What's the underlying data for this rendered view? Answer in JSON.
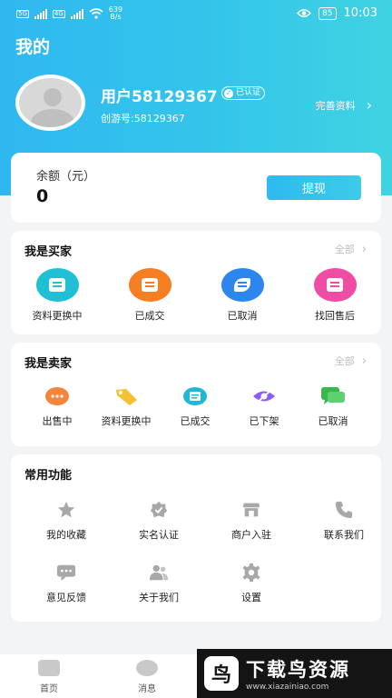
{
  "status_bar": {
    "time": "10:03",
    "battery": "85",
    "net_speed": "639",
    "net_unit": "B/s",
    "sim_tag": "5G",
    "sim_tag2": "4G"
  },
  "header": {
    "title": "我的"
  },
  "profile": {
    "username": "用户58129367",
    "verified_badge": "已认证",
    "chuangyou_id": "创游号:58129367",
    "complete_profile": "完善资料"
  },
  "balance": {
    "label": "余额（元）",
    "value": "0",
    "withdraw_button": "提现"
  },
  "buyer": {
    "title": "我是买家",
    "all": "全部",
    "items": [
      {
        "label": "资料更换中",
        "icon": "document-icon",
        "color": "#1fc0d4"
      },
      {
        "label": "已成交",
        "icon": "bag-icon",
        "color": "#f57f22"
      },
      {
        "label": "已取消",
        "icon": "leaf-icon",
        "color": "#2d86ee"
      },
      {
        "label": "找回售后",
        "icon": "list-icon",
        "color": "#ee4da3"
      }
    ]
  },
  "seller": {
    "title": "我是卖家",
    "all": "全部",
    "items": [
      {
        "label": "出售中",
        "icon": "dots-icon",
        "color": "#f5853a"
      },
      {
        "label": "资料更换中",
        "icon": "tag-icon",
        "color": "#f5c032"
      },
      {
        "label": "已成交",
        "icon": "receipt-icon",
        "color": "#1fb6d8"
      },
      {
        "label": "已下架",
        "icon": "hidden-eye-icon",
        "color": "#8a5ef0"
      },
      {
        "label": "已取消",
        "icon": "chat-icon",
        "color": "#37b84a"
      }
    ]
  },
  "common": {
    "title": "常用功能",
    "items": [
      {
        "label": "我的收藏",
        "icon": "star-icon"
      },
      {
        "label": "实名认证",
        "icon": "verified-shield-icon"
      },
      {
        "label": "商户入驻",
        "icon": "store-icon"
      },
      {
        "label": "联系我们",
        "icon": "phone-icon"
      },
      {
        "label": "意见反馈",
        "icon": "feedback-icon"
      },
      {
        "label": "关于我们",
        "icon": "people-icon"
      },
      {
        "label": "设置",
        "icon": "gear-icon"
      }
    ]
  },
  "tabbar": {
    "home": "首页",
    "messages": "消息"
  },
  "watermark": {
    "logo_char": "鸟",
    "title": "下载鸟资源",
    "url": "www.xiazainiao.com"
  }
}
